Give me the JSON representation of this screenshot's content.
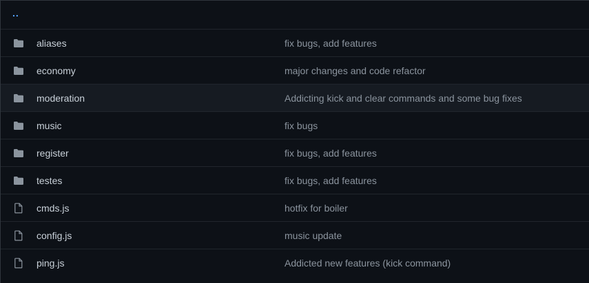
{
  "parent": {
    "label": ".."
  },
  "rows": [
    {
      "type": "folder",
      "name": "aliases",
      "message": "fix bugs, add features"
    },
    {
      "type": "folder",
      "name": "economy",
      "message": "major changes and code refactor"
    },
    {
      "type": "folder",
      "name": "moderation",
      "message": "Addicting kick and clear commands and some bug fixes"
    },
    {
      "type": "folder",
      "name": "music",
      "message": "fix bugs"
    },
    {
      "type": "folder",
      "name": "register",
      "message": "fix bugs, add features"
    },
    {
      "type": "folder",
      "name": "testes",
      "message": "fix bugs, add features"
    },
    {
      "type": "file",
      "name": "cmds.js",
      "message": "hotfix for boiler"
    },
    {
      "type": "file",
      "name": "config.js",
      "message": "music update"
    },
    {
      "type": "file",
      "name": "ping.js",
      "message": "Addicted new features (kick command)"
    }
  ],
  "colors": {
    "background": "#0d1117",
    "highlight_row": "#161b22",
    "link": "#58a6ff",
    "folder_icon": "#8b949e",
    "file_icon": "#8b949e",
    "text": "#c9d1d9",
    "muted_text": "#8b949e"
  },
  "highlighted_row": "moderation"
}
